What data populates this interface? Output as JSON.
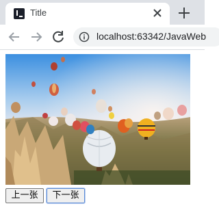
{
  "tab": {
    "title": "Title"
  },
  "address_bar": {
    "url": "localhost:63342/JavaWeb"
  },
  "image": {
    "subject": "hot-air-balloons-photo"
  },
  "buttons": {
    "previous": "上一张",
    "next": "下一张"
  }
}
